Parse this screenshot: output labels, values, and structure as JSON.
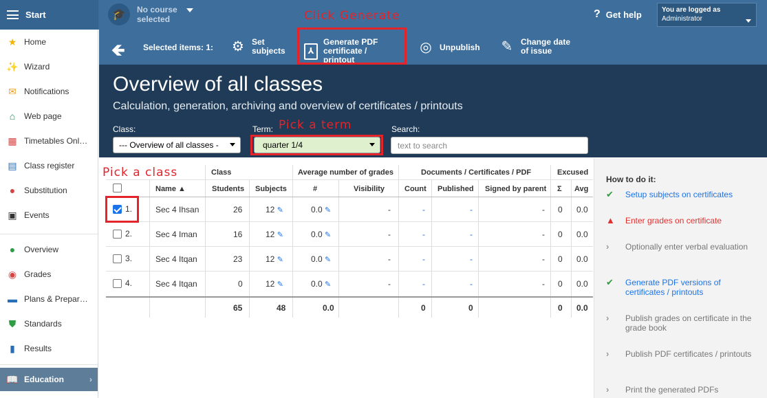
{
  "topbar": {
    "start_label": "Start",
    "course_text": "No course selected",
    "help_label": "Get help",
    "logged_label": "You are logged as",
    "logged_user": "Administrator"
  },
  "sidebar": {
    "items": [
      {
        "label": "Home",
        "icon": "star-icon"
      },
      {
        "label": "Wizard",
        "icon": "wand-icon"
      },
      {
        "label": "Notifications",
        "icon": "envelope-icon"
      },
      {
        "label": "Web page",
        "icon": "house-icon"
      },
      {
        "label": "Timetables Onl…",
        "icon": "calendar-icon"
      },
      {
        "label": "Class register",
        "icon": "book-icon"
      },
      {
        "label": "Substitution",
        "icon": "person-icon"
      },
      {
        "label": "Events",
        "icon": "events-icon"
      },
      {
        "label": "Overview",
        "icon": "check-circle-icon"
      },
      {
        "label": "Grades",
        "icon": "grades-icon"
      },
      {
        "label": "Plans & Prepar…",
        "icon": "briefcase-icon"
      },
      {
        "label": "Standards",
        "icon": "shield-icon"
      },
      {
        "label": "Results",
        "icon": "bar-chart-icon"
      }
    ],
    "active_label": "Education"
  },
  "toolbar": {
    "selected_label": "Selected items: 1:",
    "set_subjects": "Set subjects",
    "generate_pdf": "Generate PDF certificate / printout",
    "unpublish": "Unpublish",
    "change_date": "Change date of issue"
  },
  "header": {
    "title": "Overview of all classes",
    "subtitle": "Calculation, generation, archiving and overview of certificates / printouts",
    "class_label": "Class:",
    "class_value": "--- Overview of all classes -",
    "term_label": "Term:",
    "term_value": "quarter 1/4",
    "search_label": "Search:",
    "search_placeholder": "text to search"
  },
  "table": {
    "group_headers": {
      "class": "Class",
      "avg": "Average number of grades",
      "docs": "Documents / Certificates / PDF",
      "excused": "Excused"
    },
    "columns": {
      "name": "Name ▲",
      "students": "Students",
      "subjects": "Subjects",
      "hash": "#",
      "visibility": "Visibility",
      "count": "Count",
      "published": "Published",
      "signed": "Signed by parent",
      "sigma": "Σ",
      "avg": "Avg"
    },
    "rows": [
      {
        "num": "1.",
        "checked": true,
        "name": "Sec 4 Ihsan",
        "students": "26",
        "subjects": "12",
        "avg": "0.0",
        "visibility": "-",
        "count": "-",
        "published": "-",
        "signed": "-",
        "sigma": "0",
        "exavg": "0.0"
      },
      {
        "num": "2.",
        "checked": false,
        "name": "Sec 4 Iman",
        "students": "16",
        "subjects": "12",
        "avg": "0.0",
        "visibility": "-",
        "count": "-",
        "published": "-",
        "signed": "-",
        "sigma": "0",
        "exavg": "0.0"
      },
      {
        "num": "3.",
        "checked": false,
        "name": "Sec 4 Itqan",
        "students": "23",
        "subjects": "12",
        "avg": "0.0",
        "visibility": "-",
        "count": "-",
        "published": "-",
        "signed": "-",
        "sigma": "0",
        "exavg": "0.0"
      },
      {
        "num": "4.",
        "checked": false,
        "name": "Sec 4 Itqan",
        "students": "0",
        "subjects": "12",
        "avg": "0.0",
        "visibility": "-",
        "count": "-",
        "published": "-",
        "signed": "-",
        "sigma": "0",
        "exavg": "0.0"
      }
    ],
    "totals": {
      "students": "65",
      "subjects": "48",
      "avg": "0.0",
      "count": "0",
      "published": "0",
      "sigma": "0",
      "exavg": "0.0"
    }
  },
  "howto": {
    "title": "How to do it:",
    "steps": [
      {
        "label": "Setup subjects on certificates",
        "status": "ok"
      },
      {
        "label": "Enter grades on certificate",
        "status": "warn"
      },
      {
        "label": "Optionally enter verbal evaluation",
        "status": "todo"
      },
      {
        "label": "Generate PDF versions of certificates / printouts",
        "status": "ok"
      },
      {
        "label": "Publish grades on certificate in the grade book",
        "status": "todo"
      },
      {
        "label": "Publish PDF certificates / printouts",
        "status": "todo"
      },
      {
        "label": "Print the generated PDFs",
        "status": "todo"
      }
    ]
  },
  "annotations": {
    "generate": "Click Generate",
    "term": "Pick a term",
    "class": "Pick a class"
  },
  "colors": {
    "topbar": "#3d6e9c",
    "header": "#1f3b57",
    "annotation": "#e3242b",
    "link": "#1a73e8"
  }
}
